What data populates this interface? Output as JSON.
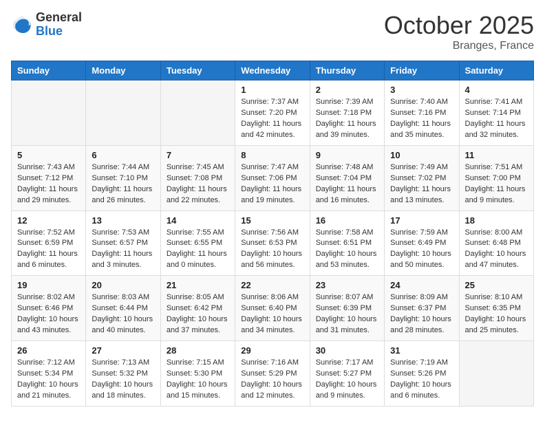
{
  "header": {
    "logo_general": "General",
    "logo_blue": "Blue",
    "month": "October 2025",
    "location": "Branges, France"
  },
  "weekdays": [
    "Sunday",
    "Monday",
    "Tuesday",
    "Wednesday",
    "Thursday",
    "Friday",
    "Saturday"
  ],
  "weeks": [
    [
      {
        "day": "",
        "info": ""
      },
      {
        "day": "",
        "info": ""
      },
      {
        "day": "",
        "info": ""
      },
      {
        "day": "1",
        "info": "Sunrise: 7:37 AM\nSunset: 7:20 PM\nDaylight: 11 hours\nand 42 minutes."
      },
      {
        "day": "2",
        "info": "Sunrise: 7:39 AM\nSunset: 7:18 PM\nDaylight: 11 hours\nand 39 minutes."
      },
      {
        "day": "3",
        "info": "Sunrise: 7:40 AM\nSunset: 7:16 PM\nDaylight: 11 hours\nand 35 minutes."
      },
      {
        "day": "4",
        "info": "Sunrise: 7:41 AM\nSunset: 7:14 PM\nDaylight: 11 hours\nand 32 minutes."
      }
    ],
    [
      {
        "day": "5",
        "info": "Sunrise: 7:43 AM\nSunset: 7:12 PM\nDaylight: 11 hours\nand 29 minutes."
      },
      {
        "day": "6",
        "info": "Sunrise: 7:44 AM\nSunset: 7:10 PM\nDaylight: 11 hours\nand 26 minutes."
      },
      {
        "day": "7",
        "info": "Sunrise: 7:45 AM\nSunset: 7:08 PM\nDaylight: 11 hours\nand 22 minutes."
      },
      {
        "day": "8",
        "info": "Sunrise: 7:47 AM\nSunset: 7:06 PM\nDaylight: 11 hours\nand 19 minutes."
      },
      {
        "day": "9",
        "info": "Sunrise: 7:48 AM\nSunset: 7:04 PM\nDaylight: 11 hours\nand 16 minutes."
      },
      {
        "day": "10",
        "info": "Sunrise: 7:49 AM\nSunset: 7:02 PM\nDaylight: 11 hours\nand 13 minutes."
      },
      {
        "day": "11",
        "info": "Sunrise: 7:51 AM\nSunset: 7:00 PM\nDaylight: 11 hours\nand 9 minutes."
      }
    ],
    [
      {
        "day": "12",
        "info": "Sunrise: 7:52 AM\nSunset: 6:59 PM\nDaylight: 11 hours\nand 6 minutes."
      },
      {
        "day": "13",
        "info": "Sunrise: 7:53 AM\nSunset: 6:57 PM\nDaylight: 11 hours\nand 3 minutes."
      },
      {
        "day": "14",
        "info": "Sunrise: 7:55 AM\nSunset: 6:55 PM\nDaylight: 11 hours\nand 0 minutes."
      },
      {
        "day": "15",
        "info": "Sunrise: 7:56 AM\nSunset: 6:53 PM\nDaylight: 10 hours\nand 56 minutes."
      },
      {
        "day": "16",
        "info": "Sunrise: 7:58 AM\nSunset: 6:51 PM\nDaylight: 10 hours\nand 53 minutes."
      },
      {
        "day": "17",
        "info": "Sunrise: 7:59 AM\nSunset: 6:49 PM\nDaylight: 10 hours\nand 50 minutes."
      },
      {
        "day": "18",
        "info": "Sunrise: 8:00 AM\nSunset: 6:48 PM\nDaylight: 10 hours\nand 47 minutes."
      }
    ],
    [
      {
        "day": "19",
        "info": "Sunrise: 8:02 AM\nSunset: 6:46 PM\nDaylight: 10 hours\nand 43 minutes."
      },
      {
        "day": "20",
        "info": "Sunrise: 8:03 AM\nSunset: 6:44 PM\nDaylight: 10 hours\nand 40 minutes."
      },
      {
        "day": "21",
        "info": "Sunrise: 8:05 AM\nSunset: 6:42 PM\nDaylight: 10 hours\nand 37 minutes."
      },
      {
        "day": "22",
        "info": "Sunrise: 8:06 AM\nSunset: 6:40 PM\nDaylight: 10 hours\nand 34 minutes."
      },
      {
        "day": "23",
        "info": "Sunrise: 8:07 AM\nSunset: 6:39 PM\nDaylight: 10 hours\nand 31 minutes."
      },
      {
        "day": "24",
        "info": "Sunrise: 8:09 AM\nSunset: 6:37 PM\nDaylight: 10 hours\nand 28 minutes."
      },
      {
        "day": "25",
        "info": "Sunrise: 8:10 AM\nSunset: 6:35 PM\nDaylight: 10 hours\nand 25 minutes."
      }
    ],
    [
      {
        "day": "26",
        "info": "Sunrise: 7:12 AM\nSunset: 5:34 PM\nDaylight: 10 hours\nand 21 minutes."
      },
      {
        "day": "27",
        "info": "Sunrise: 7:13 AM\nSunset: 5:32 PM\nDaylight: 10 hours\nand 18 minutes."
      },
      {
        "day": "28",
        "info": "Sunrise: 7:15 AM\nSunset: 5:30 PM\nDaylight: 10 hours\nand 15 minutes."
      },
      {
        "day": "29",
        "info": "Sunrise: 7:16 AM\nSunset: 5:29 PM\nDaylight: 10 hours\nand 12 minutes."
      },
      {
        "day": "30",
        "info": "Sunrise: 7:17 AM\nSunset: 5:27 PM\nDaylight: 10 hours\nand 9 minutes."
      },
      {
        "day": "31",
        "info": "Sunrise: 7:19 AM\nSunset: 5:26 PM\nDaylight: 10 hours\nand 6 minutes."
      },
      {
        "day": "",
        "info": ""
      }
    ]
  ]
}
